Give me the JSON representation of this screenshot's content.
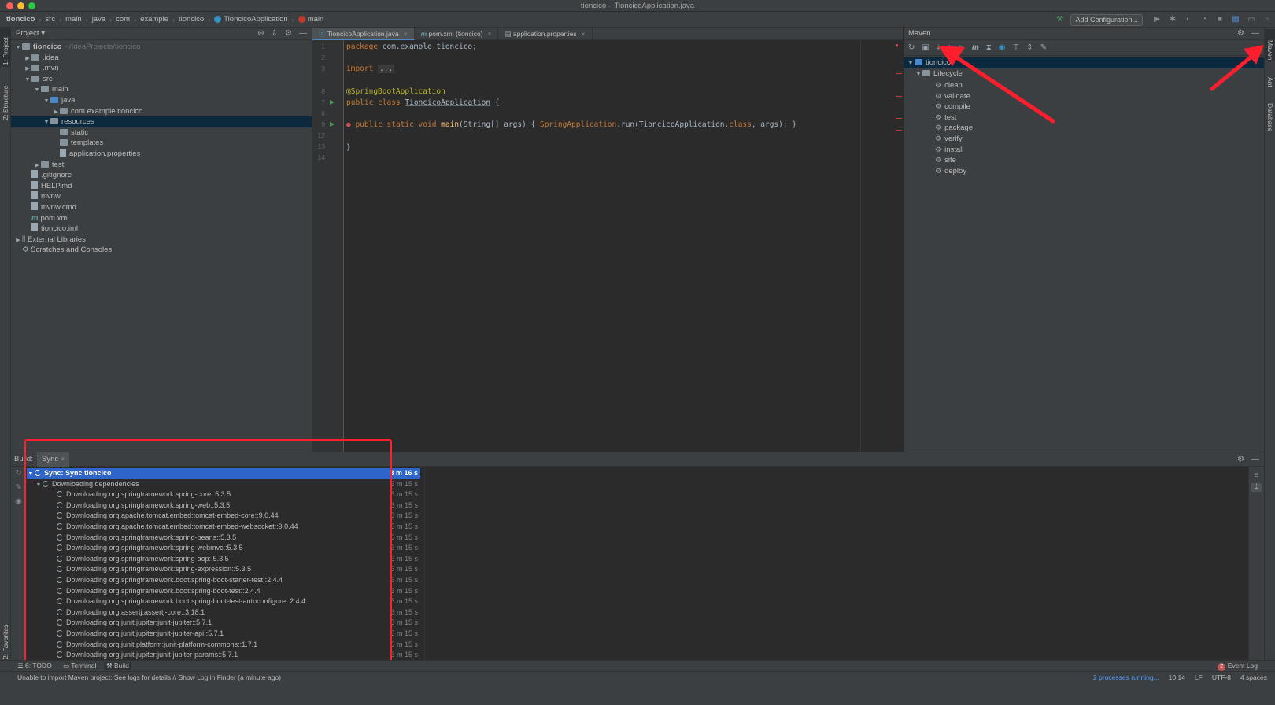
{
  "window": {
    "title": "tioncico – TioncicoApplication.java"
  },
  "breadcrumb": [
    "tioncico",
    "src",
    "main",
    "java",
    "com",
    "example",
    "tioncico",
    "TioncicoApplication",
    "main"
  ],
  "toolbar": {
    "add_configuration": "Add Configuration..."
  },
  "left_strip": {
    "project_tab": "1: Project",
    "structure_tab": "Z: Structure",
    "favorites_tab": "2: Favorites"
  },
  "right_strip": {
    "maven_tab": "Maven",
    "ant_tab": "Ant",
    "database_tab": "Database"
  },
  "project_panel": {
    "title": "Project",
    "tree": [
      {
        "label": "tioncico",
        "suffix": "~/IdeaProjects/tioncico",
        "depth": 0,
        "arrow": "open",
        "icon": "folder"
      },
      {
        "label": ".idea",
        "depth": 1,
        "arrow": "closed",
        "icon": "folder"
      },
      {
        "label": ".mvn",
        "depth": 1,
        "arrow": "closed",
        "icon": "folder"
      },
      {
        "label": "src",
        "depth": 1,
        "arrow": "open",
        "icon": "folder"
      },
      {
        "label": "main",
        "depth": 2,
        "arrow": "open",
        "icon": "folder"
      },
      {
        "label": "java",
        "depth": 3,
        "arrow": "open",
        "icon": "folder-blue"
      },
      {
        "label": "com.example.tioncico",
        "depth": 4,
        "arrow": "closed",
        "icon": "package"
      },
      {
        "label": "resources",
        "depth": 3,
        "arrow": "open",
        "icon": "folder",
        "selected": true
      },
      {
        "label": "static",
        "depth": 4,
        "arrow": "",
        "icon": "folder"
      },
      {
        "label": "templates",
        "depth": 4,
        "arrow": "",
        "icon": "folder"
      },
      {
        "label": "application.properties",
        "depth": 4,
        "arrow": "",
        "icon": "file"
      },
      {
        "label": "test",
        "depth": 2,
        "arrow": "closed",
        "icon": "folder"
      },
      {
        "label": ".gitignore",
        "depth": 1,
        "arrow": "",
        "icon": "file"
      },
      {
        "label": "HELP.md",
        "depth": 1,
        "arrow": "",
        "icon": "file"
      },
      {
        "label": "mvnw",
        "depth": 1,
        "arrow": "",
        "icon": "file"
      },
      {
        "label": "mvnw.cmd",
        "depth": 1,
        "arrow": "",
        "icon": "file"
      },
      {
        "label": "pom.xml",
        "depth": 1,
        "arrow": "",
        "icon": "maven"
      },
      {
        "label": "tioncico.iml",
        "depth": 1,
        "arrow": "",
        "icon": "file"
      },
      {
        "label": "External Libraries",
        "depth": 0,
        "arrow": "closed",
        "icon": "library"
      },
      {
        "label": "Scratches and Consoles",
        "depth": 0,
        "arrow": "",
        "icon": "scratch"
      }
    ]
  },
  "editor": {
    "tabs": [
      {
        "label": "TioncicoApplication.java",
        "active": true
      },
      {
        "label": "pom.xml (tioncico)",
        "active": false
      },
      {
        "label": "application.properties",
        "active": false
      }
    ],
    "line_numbers": [
      "1",
      "2",
      "3",
      "6",
      "7",
      "8",
      "9",
      "12",
      "13",
      "14"
    ],
    "code": {
      "l1_kw": "package",
      "l1_rest": " com.example.tioncico;",
      "l3_kw": "import",
      "l3_fold": "...",
      "l6": "@SpringBootApplication",
      "l7_kw": "public class",
      "l7_cls": "TioncicoApplication",
      "l7_rest": " {",
      "l9_kw": "public static void",
      "l9_fn": "main",
      "l9_args": "(String[] args) {",
      "l9_call_cls": "SpringApplication",
      "l9_call": ".run(TioncicoApplication.",
      "l9_class_kw": "class",
      "l9_end": ", args); }",
      "l13": "}"
    }
  },
  "maven_panel": {
    "title": "Maven",
    "project": "tioncico",
    "lifecycle": "Lifecycle",
    "goals": [
      "clean",
      "validate",
      "compile",
      "test",
      "package",
      "verify",
      "install",
      "site",
      "deploy"
    ]
  },
  "build_panel": {
    "label": "Build:",
    "tab": "Sync",
    "root": {
      "label": "Sync: Sync tioncico",
      "time": "3 m 16 s"
    },
    "group": {
      "label": "Downloading dependencies",
      "time": "3 m 15 s"
    },
    "items": [
      {
        "label": "Downloading org.springframework:spring-core::5.3.5",
        "time": "3 m 15 s"
      },
      {
        "label": "Downloading org.springframework:spring-web::5.3.5",
        "time": "3 m 15 s"
      },
      {
        "label": "Downloading org.apache.tomcat.embed:tomcat-embed-core::9.0.44",
        "time": "3 m 15 s"
      },
      {
        "label": "Downloading org.apache.tomcat.embed:tomcat-embed-websocket::9.0.44",
        "time": "3 m 15 s"
      },
      {
        "label": "Downloading org.springframework:spring-beans::5.3.5",
        "time": "3 m 15 s"
      },
      {
        "label": "Downloading org.springframework:spring-webmvc::5.3.5",
        "time": "3 m 15 s"
      },
      {
        "label": "Downloading org.springframework:spring-aop::5.3.5",
        "time": "3 m 15 s"
      },
      {
        "label": "Downloading org.springframework:spring-expression::5.3.5",
        "time": "3 m 15 s"
      },
      {
        "label": "Downloading org.springframework.boot:spring-boot-starter-test::2.4.4",
        "time": "3 m 15 s"
      },
      {
        "label": "Downloading org.springframework.boot:spring-boot-test::2.4.4",
        "time": "3 m 15 s"
      },
      {
        "label": "Downloading org.springframework.boot:spring-boot-test-autoconfigure::2.4.4",
        "time": "3 m 15 s"
      },
      {
        "label": "Downloading org.assertj:assertj-core::3.18.1",
        "time": "3 m 15 s"
      },
      {
        "label": "Downloading org.junit.jupiter:junit-jupiter::5.7.1",
        "time": "3 m 15 s"
      },
      {
        "label": "Downloading org.junit.jupiter:junit-jupiter-api::5.7.1",
        "time": "3 m 15 s"
      },
      {
        "label": "Downloading org.junit.platform:junit-platform-commons::1.7.1",
        "time": "3 m 15 s"
      },
      {
        "label": "Downloading org.junit.jupiter:junit-jupiter-params::5.7.1",
        "time": "3 m 15 s"
      }
    ]
  },
  "bottom_tabs": {
    "todo": "6: TODO",
    "terminal": "Terminal",
    "build": "Build",
    "event_log": "Event Log",
    "event_count": "2"
  },
  "status": {
    "message": "Unable to import Maven project: See logs for details // Show Log in Finder (a minute ago)",
    "processes": "2 processes running...",
    "position": "10:14",
    "line_sep": "LF",
    "encoding": "UTF-8",
    "indent": "4 spaces"
  },
  "colors": {
    "accent": "#2f65ca",
    "annotation_red": "#ff1e2d",
    "background": "#2b2b2b",
    "panel": "#3c3f41"
  }
}
